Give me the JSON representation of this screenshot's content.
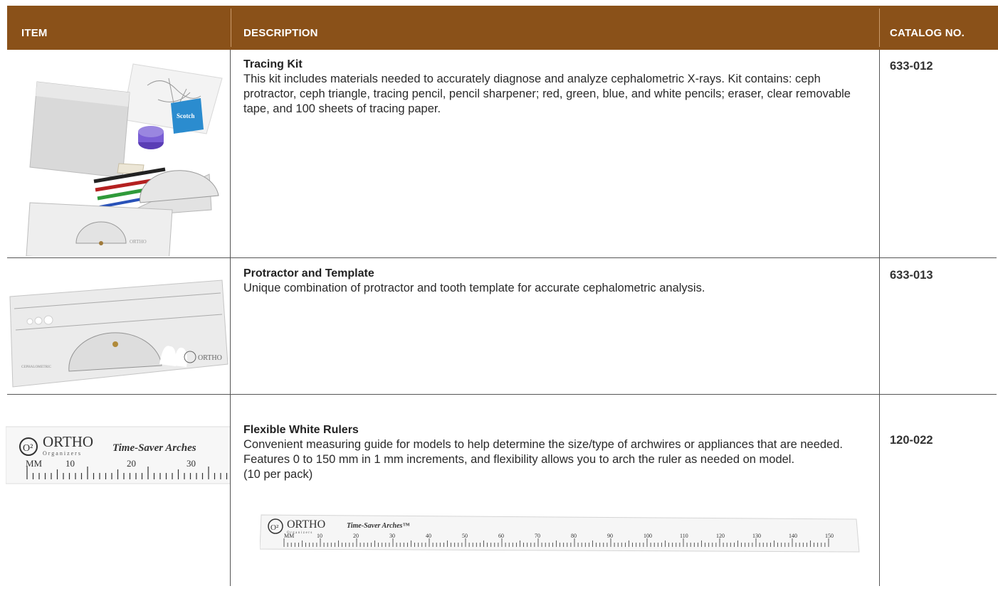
{
  "header": {
    "item_label": "ITEM",
    "description_label": "DESCRIPTION",
    "catalog_label": "CATALOG NO."
  },
  "colors": {
    "header_bg": "#8a5119",
    "header_text": "#ffffff"
  },
  "rows": [
    {
      "image_icon": "tracing-kit-photo",
      "title": "Tracing Kit",
      "description": "This kit includes materials needed to accurately diagnose and analyze cephalometric X-rays. Kit contains: ceph protractor, ceph triangle, tracing pencil, pencil sharpener; red, green, blue, and white pencils; eraser, clear removable tape, and 100 sheets of tracing paper.",
      "catalog_no": "633-012"
    },
    {
      "image_icon": "protractor-template-photo",
      "title": "Protractor and Template",
      "description": "Unique combination of protractor and tooth template for accurate cephalometric analysis.",
      "catalog_no": "633-013"
    },
    {
      "image_icon": "white-ruler-photo",
      "title": "Flexible White Rulers",
      "description": "Convenient measuring guide for models to help determine the size/type of archwires or appliances that are needed. Features 0 to 150 mm in 1 mm increments, and flexibility allows you to arch the ruler as needed on model.",
      "pack_note": "(10 per pack)",
      "catalog_no": "120-022"
    }
  ],
  "ruler": {
    "brand": "ORTHO",
    "brand_sub": "Organizers",
    "product": "Time-Saver Arches",
    "product_tm": "Time-Saver Arches™",
    "unit": "MM",
    "ticks_small": [
      "10",
      "20",
      "30"
    ],
    "ticks_full": [
      "10",
      "20",
      "30",
      "40",
      "50",
      "60",
      "70",
      "80",
      "90",
      "100",
      "110",
      "120",
      "130",
      "140",
      "150"
    ]
  }
}
